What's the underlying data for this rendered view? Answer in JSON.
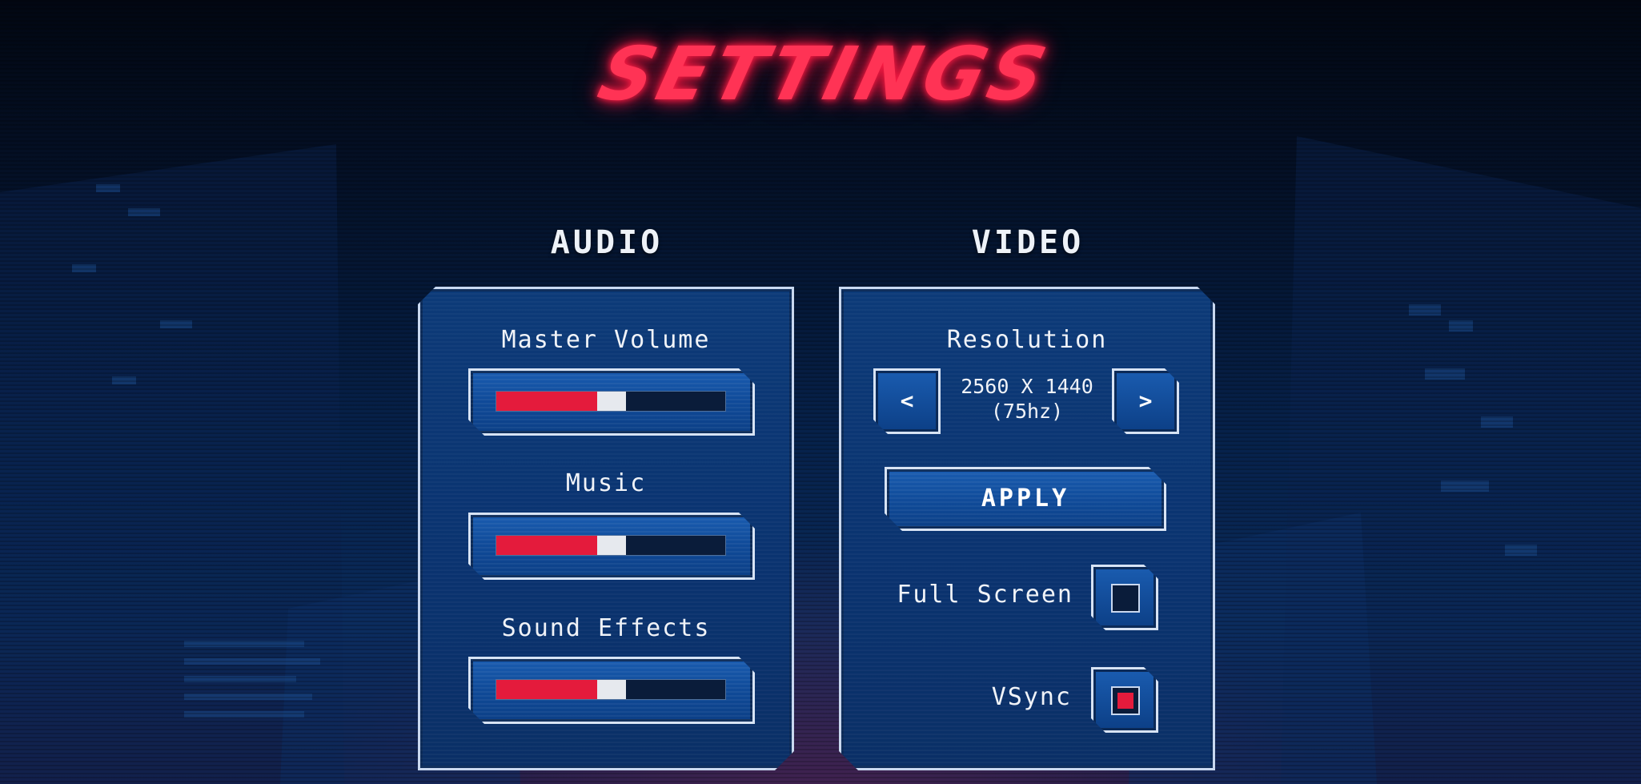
{
  "title": "SETTINGS",
  "colors": {
    "accent_red": "#e41b3c",
    "panel_blue": "#0c3a78",
    "frame": "#d7e3f4",
    "text": "#f0f3f8"
  },
  "audio": {
    "heading": "AUDIO",
    "sliders": [
      {
        "label": "Master Volume",
        "value": 0.44
      },
      {
        "label": "Music",
        "value": 0.44
      },
      {
        "label": "Sound Effects",
        "value": 0.44
      }
    ]
  },
  "video": {
    "heading": "VIDEO",
    "resolution": {
      "label": "Resolution",
      "value": "2560 X 1440",
      "refresh": "(75hz)",
      "prev_label": "<",
      "next_label": ">"
    },
    "apply_label": "APPLY",
    "full_screen": {
      "label": "Full Screen",
      "checked": false
    },
    "vsync": {
      "label": "VSync",
      "checked": true
    }
  }
}
